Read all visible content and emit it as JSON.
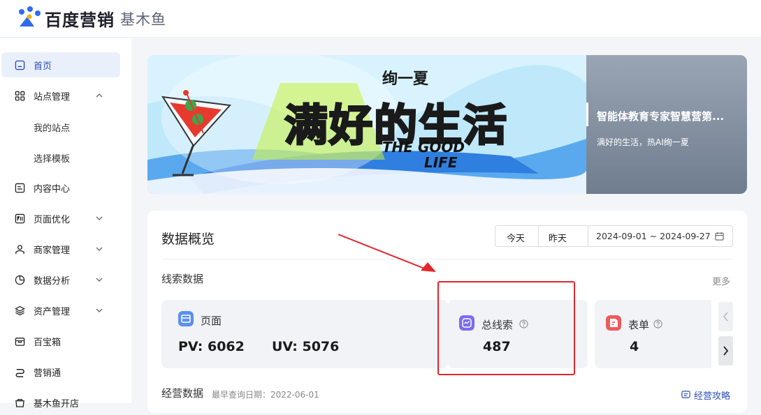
{
  "header": {
    "brand": "百度营销",
    "product": "基木鱼"
  },
  "sidebar": {
    "items": [
      {
        "label": "首页",
        "icon": "home-icon"
      },
      {
        "label": "站点管理",
        "icon": "grid-icon"
      },
      {
        "label": "内容中心",
        "icon": "content-icon"
      },
      {
        "label": "页面优化",
        "icon": "optimize-icon"
      },
      {
        "label": "商家管理",
        "icon": "merchant-icon"
      },
      {
        "label": "数据分析",
        "icon": "analytics-icon"
      },
      {
        "label": "资产管理",
        "icon": "assets-icon"
      },
      {
        "label": "百宝箱",
        "icon": "toolbox-icon"
      },
      {
        "label": "营销通",
        "icon": "marketing-icon"
      },
      {
        "label": "基木鱼开店",
        "icon": "store-icon"
      }
    ],
    "sub_items": [
      "我的站点",
      "选择模板"
    ]
  },
  "banner": {
    "small": "绚一夏",
    "headline": "满好的生活",
    "english_line1": "THE GOOD",
    "english_line2": "LIFE",
    "side_title": "智能体教育专家智慧营第...",
    "side_subtitle": "满好的生活，热AI绚一夏"
  },
  "overview": {
    "title": "数据概览",
    "today": "今天",
    "yesterday": "昨天",
    "date_range": "2024-09-01 ~ 2024-09-27",
    "leads_section": "线索数据",
    "more": "更多",
    "page_card": {
      "name": "页面",
      "pv": "PV: 6062",
      "uv": "UV: 5076"
    },
    "total_leads": {
      "name": "总线索",
      "value": "487"
    },
    "forms": {
      "name": "表单",
      "value": "4"
    },
    "ops_title": "经营数据",
    "ops_subtitle": "最早查询日期：2022-06-01",
    "ops_link": "经营攻略"
  },
  "colors": {
    "accent": "#2b4fb8",
    "highlight": "#e3262a",
    "total_leads_icon": "#7b6cf0",
    "form_icon": "#ee5a5a",
    "page_icon": "#5b8ff0"
  }
}
